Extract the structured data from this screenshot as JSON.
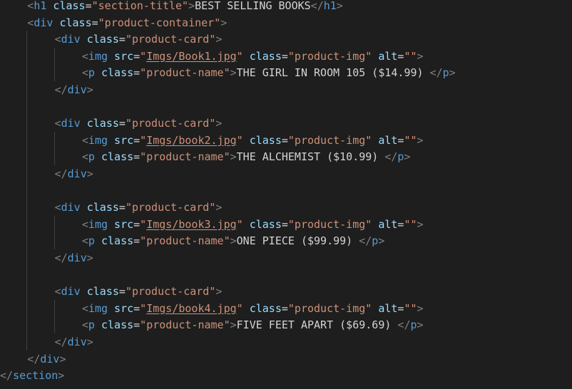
{
  "colors": {
    "background": "#1e1e1e",
    "bracket": "#808080",
    "tag": "#569cd6",
    "attribute": "#9cdcfe",
    "string": "#ce9178",
    "text": "#d4d4d4",
    "indent_guide": "#404040"
  },
  "lines": [
    {
      "indent": 1,
      "tokens": [
        {
          "t": "bracket",
          "v": "<"
        },
        {
          "t": "tag",
          "v": "h1"
        },
        {
          "t": "text",
          "v": " "
        },
        {
          "t": "attr",
          "v": "class"
        },
        {
          "t": "eq",
          "v": "="
        },
        {
          "t": "string",
          "v": "\"section-title\""
        },
        {
          "t": "bracket",
          "v": ">"
        },
        {
          "t": "text",
          "v": "BEST SELLING BOOKS"
        },
        {
          "t": "bracket",
          "v": "</"
        },
        {
          "t": "tag",
          "v": "h1"
        },
        {
          "t": "bracket",
          "v": ">"
        }
      ]
    },
    {
      "indent": 1,
      "tokens": [
        {
          "t": "bracket",
          "v": "<"
        },
        {
          "t": "tag",
          "v": "div"
        },
        {
          "t": "text",
          "v": " "
        },
        {
          "t": "attr",
          "v": "class"
        },
        {
          "t": "eq",
          "v": "="
        },
        {
          "t": "string",
          "v": "\"product-container\""
        },
        {
          "t": "bracket",
          "v": ">"
        }
      ]
    },
    {
      "indent": 2,
      "tokens": [
        {
          "t": "bracket",
          "v": "<"
        },
        {
          "t": "tag",
          "v": "div"
        },
        {
          "t": "text",
          "v": " "
        },
        {
          "t": "attr",
          "v": "class"
        },
        {
          "t": "eq",
          "v": "="
        },
        {
          "t": "string",
          "v": "\"product-card\""
        },
        {
          "t": "bracket",
          "v": ">"
        }
      ]
    },
    {
      "indent": 3,
      "tokens": [
        {
          "t": "bracket",
          "v": "<"
        },
        {
          "t": "tag",
          "v": "img"
        },
        {
          "t": "text",
          "v": " "
        },
        {
          "t": "attr",
          "v": "src"
        },
        {
          "t": "eq",
          "v": "="
        },
        {
          "t": "string",
          "v": "\""
        },
        {
          "t": "link",
          "v": "Imgs/Book1.jpg"
        },
        {
          "t": "string",
          "v": "\""
        },
        {
          "t": "text",
          "v": " "
        },
        {
          "t": "attr",
          "v": "class"
        },
        {
          "t": "eq",
          "v": "="
        },
        {
          "t": "string",
          "v": "\"product-img\""
        },
        {
          "t": "text",
          "v": " "
        },
        {
          "t": "attr",
          "v": "alt"
        },
        {
          "t": "eq",
          "v": "="
        },
        {
          "t": "string",
          "v": "\"\""
        },
        {
          "t": "bracket",
          "v": ">"
        }
      ]
    },
    {
      "indent": 3,
      "tokens": [
        {
          "t": "bracket",
          "v": "<"
        },
        {
          "t": "tag",
          "v": "p"
        },
        {
          "t": "text",
          "v": " "
        },
        {
          "t": "attr",
          "v": "class"
        },
        {
          "t": "eq",
          "v": "="
        },
        {
          "t": "string",
          "v": "\"product-name\""
        },
        {
          "t": "bracket",
          "v": ">"
        },
        {
          "t": "text",
          "v": "THE GIRL IN ROOM 105 ($14.99) "
        },
        {
          "t": "bracket",
          "v": "</"
        },
        {
          "t": "tag",
          "v": "p"
        },
        {
          "t": "bracket",
          "v": ">"
        }
      ]
    },
    {
      "indent": 2,
      "tokens": [
        {
          "t": "bracket",
          "v": "</"
        },
        {
          "t": "tag",
          "v": "div"
        },
        {
          "t": "bracket",
          "v": ">"
        }
      ]
    },
    {
      "indent": 0,
      "tokens": []
    },
    {
      "indent": 2,
      "tokens": [
        {
          "t": "bracket",
          "v": "<"
        },
        {
          "t": "tag",
          "v": "div"
        },
        {
          "t": "text",
          "v": " "
        },
        {
          "t": "attr",
          "v": "class"
        },
        {
          "t": "eq",
          "v": "="
        },
        {
          "t": "string",
          "v": "\"product-card\""
        },
        {
          "t": "bracket",
          "v": ">"
        }
      ]
    },
    {
      "indent": 3,
      "tokens": [
        {
          "t": "bracket",
          "v": "<"
        },
        {
          "t": "tag",
          "v": "img"
        },
        {
          "t": "text",
          "v": " "
        },
        {
          "t": "attr",
          "v": "src"
        },
        {
          "t": "eq",
          "v": "="
        },
        {
          "t": "string",
          "v": "\""
        },
        {
          "t": "link",
          "v": "Imgs/book2.jpg"
        },
        {
          "t": "string",
          "v": "\""
        },
        {
          "t": "text",
          "v": " "
        },
        {
          "t": "attr",
          "v": "class"
        },
        {
          "t": "eq",
          "v": "="
        },
        {
          "t": "string",
          "v": "\"product-img\""
        },
        {
          "t": "text",
          "v": " "
        },
        {
          "t": "attr",
          "v": "alt"
        },
        {
          "t": "eq",
          "v": "="
        },
        {
          "t": "string",
          "v": "\"\""
        },
        {
          "t": "bracket",
          "v": ">"
        }
      ]
    },
    {
      "indent": 3,
      "tokens": [
        {
          "t": "bracket",
          "v": "<"
        },
        {
          "t": "tag",
          "v": "p"
        },
        {
          "t": "text",
          "v": " "
        },
        {
          "t": "attr",
          "v": "class"
        },
        {
          "t": "eq",
          "v": "="
        },
        {
          "t": "string",
          "v": "\"product-name\""
        },
        {
          "t": "bracket",
          "v": ">"
        },
        {
          "t": "text",
          "v": "THE ALCHEMIST ($10.99) "
        },
        {
          "t": "bracket",
          "v": "</"
        },
        {
          "t": "tag",
          "v": "p"
        },
        {
          "t": "bracket",
          "v": ">"
        }
      ]
    },
    {
      "indent": 2,
      "tokens": [
        {
          "t": "bracket",
          "v": "</"
        },
        {
          "t": "tag",
          "v": "div"
        },
        {
          "t": "bracket",
          "v": ">"
        }
      ]
    },
    {
      "indent": 0,
      "tokens": []
    },
    {
      "indent": 2,
      "tokens": [
        {
          "t": "bracket",
          "v": "<"
        },
        {
          "t": "tag",
          "v": "div"
        },
        {
          "t": "text",
          "v": " "
        },
        {
          "t": "attr",
          "v": "class"
        },
        {
          "t": "eq",
          "v": "="
        },
        {
          "t": "string",
          "v": "\"product-card\""
        },
        {
          "t": "bracket",
          "v": ">"
        }
      ]
    },
    {
      "indent": 3,
      "tokens": [
        {
          "t": "bracket",
          "v": "<"
        },
        {
          "t": "tag",
          "v": "img"
        },
        {
          "t": "text",
          "v": " "
        },
        {
          "t": "attr",
          "v": "src"
        },
        {
          "t": "eq",
          "v": "="
        },
        {
          "t": "string",
          "v": "\""
        },
        {
          "t": "link",
          "v": "Imgs/book3.jpg"
        },
        {
          "t": "string",
          "v": "\""
        },
        {
          "t": "text",
          "v": " "
        },
        {
          "t": "attr",
          "v": "class"
        },
        {
          "t": "eq",
          "v": "="
        },
        {
          "t": "string",
          "v": "\"product-img\""
        },
        {
          "t": "text",
          "v": " "
        },
        {
          "t": "attr",
          "v": "alt"
        },
        {
          "t": "eq",
          "v": "="
        },
        {
          "t": "string",
          "v": "\"\""
        },
        {
          "t": "bracket",
          "v": ">"
        }
      ]
    },
    {
      "indent": 3,
      "tokens": [
        {
          "t": "bracket",
          "v": "<"
        },
        {
          "t": "tag",
          "v": "p"
        },
        {
          "t": "text",
          "v": " "
        },
        {
          "t": "attr",
          "v": "class"
        },
        {
          "t": "eq",
          "v": "="
        },
        {
          "t": "string",
          "v": "\"product-name\""
        },
        {
          "t": "bracket",
          "v": ">"
        },
        {
          "t": "text",
          "v": "ONE PIECE ($99.99) "
        },
        {
          "t": "bracket",
          "v": "</"
        },
        {
          "t": "tag",
          "v": "p"
        },
        {
          "t": "bracket",
          "v": ">"
        }
      ]
    },
    {
      "indent": 2,
      "tokens": [
        {
          "t": "bracket",
          "v": "</"
        },
        {
          "t": "tag",
          "v": "div"
        },
        {
          "t": "bracket",
          "v": ">"
        }
      ]
    },
    {
      "indent": 0,
      "tokens": []
    },
    {
      "indent": 2,
      "tokens": [
        {
          "t": "bracket",
          "v": "<"
        },
        {
          "t": "tag",
          "v": "div"
        },
        {
          "t": "text",
          "v": " "
        },
        {
          "t": "attr",
          "v": "class"
        },
        {
          "t": "eq",
          "v": "="
        },
        {
          "t": "string",
          "v": "\"product-card\""
        },
        {
          "t": "bracket",
          "v": ">"
        }
      ]
    },
    {
      "indent": 3,
      "tokens": [
        {
          "t": "bracket",
          "v": "<"
        },
        {
          "t": "tag",
          "v": "img"
        },
        {
          "t": "text",
          "v": " "
        },
        {
          "t": "attr",
          "v": "src"
        },
        {
          "t": "eq",
          "v": "="
        },
        {
          "t": "string",
          "v": "\""
        },
        {
          "t": "link",
          "v": "Imgs/book4.jpg"
        },
        {
          "t": "string",
          "v": "\""
        },
        {
          "t": "text",
          "v": " "
        },
        {
          "t": "attr",
          "v": "class"
        },
        {
          "t": "eq",
          "v": "="
        },
        {
          "t": "string",
          "v": "\"product-img\""
        },
        {
          "t": "text",
          "v": " "
        },
        {
          "t": "attr",
          "v": "alt"
        },
        {
          "t": "eq",
          "v": "="
        },
        {
          "t": "string",
          "v": "\"\""
        },
        {
          "t": "bracket",
          "v": ">"
        }
      ]
    },
    {
      "indent": 3,
      "tokens": [
        {
          "t": "bracket",
          "v": "<"
        },
        {
          "t": "tag",
          "v": "p"
        },
        {
          "t": "text",
          "v": " "
        },
        {
          "t": "attr",
          "v": "class"
        },
        {
          "t": "eq",
          "v": "="
        },
        {
          "t": "string",
          "v": "\"product-name\""
        },
        {
          "t": "bracket",
          "v": ">"
        },
        {
          "t": "text",
          "v": "FIVE FEET APART ($69.69) "
        },
        {
          "t": "bracket",
          "v": "</"
        },
        {
          "t": "tag",
          "v": "p"
        },
        {
          "t": "bracket",
          "v": ">"
        }
      ]
    },
    {
      "indent": 2,
      "tokens": [
        {
          "t": "bracket",
          "v": "</"
        },
        {
          "t": "tag",
          "v": "div"
        },
        {
          "t": "bracket",
          "v": ">"
        }
      ]
    },
    {
      "indent": 1,
      "tokens": [
        {
          "t": "bracket",
          "v": "</"
        },
        {
          "t": "tag",
          "v": "div"
        },
        {
          "t": "bracket",
          "v": ">"
        }
      ]
    },
    {
      "indent": 0,
      "tokens": [
        {
          "t": "bracket",
          "v": "</"
        },
        {
          "t": "tag",
          "v": "section"
        },
        {
          "t": "bracket",
          "v": ">"
        }
      ]
    }
  ]
}
